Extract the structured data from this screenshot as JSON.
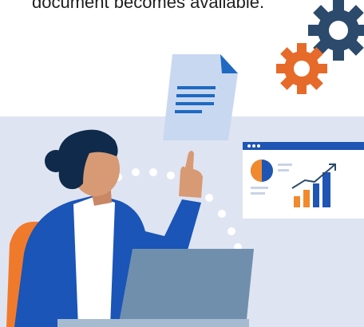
{
  "caption": {
    "text": "document becomes available."
  },
  "colors": {
    "background_band": "#dfe4f2",
    "blue_gear": "#2c4a6b",
    "orange_gear": "#e66a2a",
    "document": "#c9d8f1",
    "document_lines": "#1f69c2",
    "jacket": "#1a55b7",
    "laptop": "#6f8fad",
    "chair": "#f07a2b",
    "skin": "#d79a74",
    "hair": "#0f2a4a"
  },
  "illustration": {
    "icons": [
      "gear-icon",
      "document-icon",
      "dashboard-icon",
      "pie-chart-icon",
      "bar-chart-icon",
      "trend-arrow-icon"
    ]
  }
}
